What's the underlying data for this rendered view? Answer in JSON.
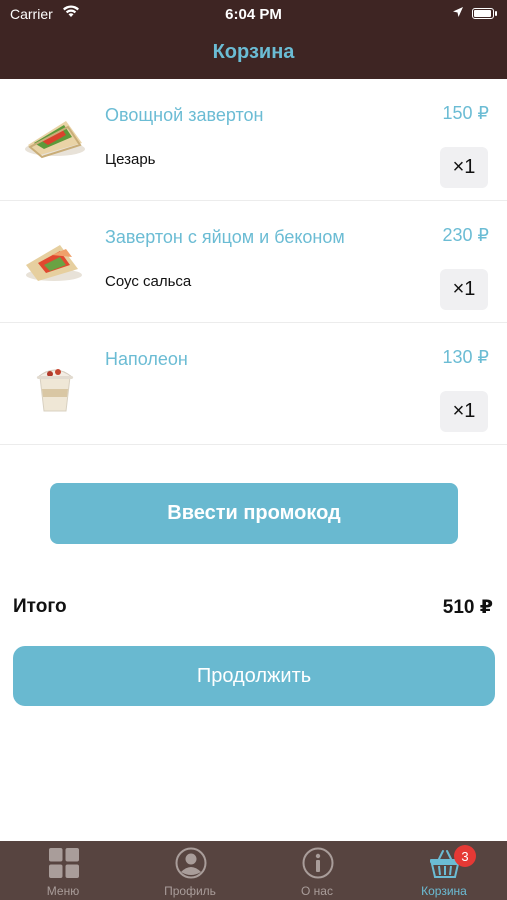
{
  "status": {
    "carrier": "Carrier",
    "time": "6:04 PM"
  },
  "header": {
    "title": "Корзина"
  },
  "cart": [
    {
      "name": "Овощной завертон",
      "price": "150 ₽",
      "option": "Цезарь",
      "qty": "×1",
      "image": "wrap-image"
    },
    {
      "name": "Завертон с яйцом и беконом",
      "price": "230 ₽",
      "option": "Соус сальса",
      "qty": "×1",
      "image": "wrap-image"
    },
    {
      "name": "Наполеон",
      "price": "130 ₽",
      "option": "",
      "qty": "×1",
      "image": "dessert-cup-image"
    }
  ],
  "promo_button": "Ввести промокод",
  "total": {
    "label": "Итого",
    "value": "510 ₽"
  },
  "continue_button": "Продолжить",
  "tabs": [
    {
      "label": "Меню",
      "icon": "grid-icon"
    },
    {
      "label": "Профиль",
      "icon": "profile-icon"
    },
    {
      "label": "О нас",
      "icon": "info-icon"
    },
    {
      "label": "Корзина",
      "icon": "basket-icon",
      "active": true
    }
  ],
  "badge": "3",
  "colors": {
    "accent": "#6bbcd4",
    "button": "#69b9d0",
    "header": "#3e2523",
    "tabbar": "#574440",
    "badge": "#e53935"
  }
}
